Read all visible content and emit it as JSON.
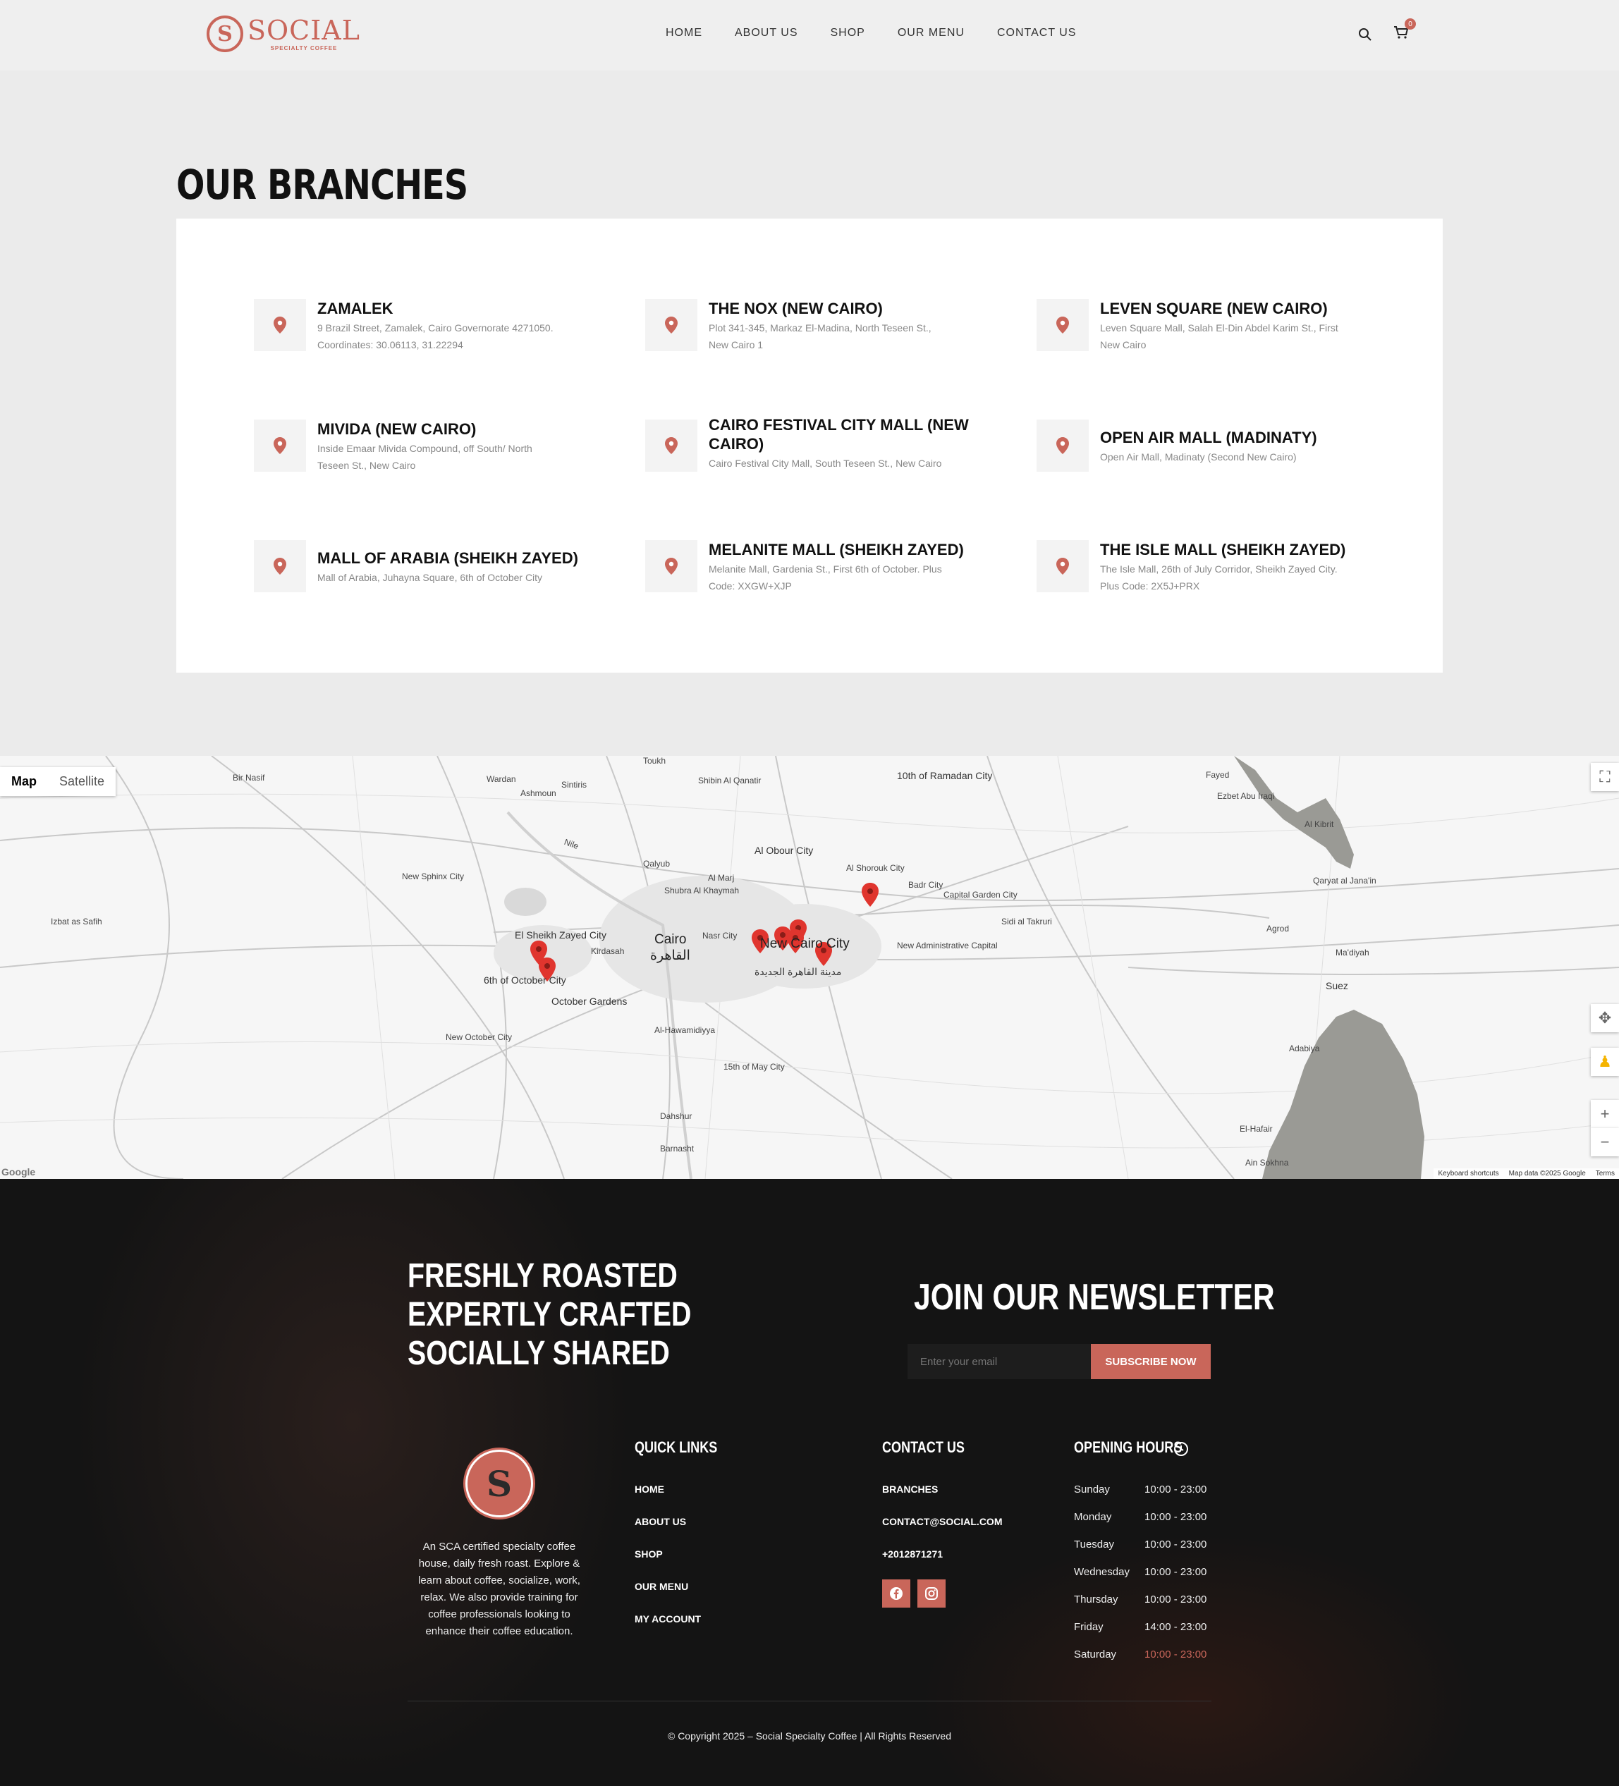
{
  "header": {
    "logo_word": "SOCIAL",
    "logo_sub": "SPECIALTY COFFEE",
    "nav": [
      "HOME",
      "ABOUT US",
      "SHOP",
      "OUR MENU",
      "CONTACT US"
    ],
    "cart_count": "0"
  },
  "branches": {
    "title": "OUR BRANCHES",
    "items": [
      {
        "name": "ZAMALEK",
        "addr1": "9 Brazil Street, Zamalek, Cairo Governorate 4271050.",
        "addr2": "Coordinates: 30.06113, 31.22294"
      },
      {
        "name": "THE NOX (NEW CAIRO)",
        "addr1": "Plot 341-345, Markaz El-Madina, North Teseen St.,",
        "addr2": "New Cairo 1"
      },
      {
        "name": "LEVEN SQUARE (NEW CAIRO)",
        "addr1": "Leven Square Mall, Salah El-Din Abdel Karim St., First",
        "addr2": "New Cairo"
      },
      {
        "name": "MIVIDA (NEW CAIRO)",
        "addr1": "Inside Emaar Mivida Compound, off South/ North",
        "addr2": "Teseen St., New Cairo"
      },
      {
        "name": "CAIRO FESTIVAL CITY MALL (NEW",
        "name2": "CAIRO)",
        "addr1": "Cairo Festival City Mall, South Teseen St., New Cairo",
        "addr2": ""
      },
      {
        "name": "OPEN AIR MALL (MADINATY)",
        "addr1": "Open Air Mall, Madinaty (Second New Cairo)",
        "addr2": ""
      },
      {
        "name": "MALL OF ARABIA (SHEIKH ZAYED)",
        "addr1": "Mall of Arabia, Juhayna Square, 6th of October City",
        "addr2": ""
      },
      {
        "name": "MELANITE MALL (SHEIKH ZAYED)",
        "addr1": "Melanite Mall, Gardenia St., First 6th of October. Plus",
        "addr2": "Code: XXGW+XJP"
      },
      {
        "name": "THE ISLE MALL (SHEIKH ZAYED)",
        "addr1": "The Isle Mall, 26th of July Corridor, Sheikh Zayed City.",
        "addr2": "Plus Code: 2X5J+PRX"
      }
    ]
  },
  "map": {
    "type_buttons": [
      "Map",
      "Satellite"
    ],
    "labels": [
      "Cairo",
      "القاهرة",
      "New Cairo City",
      "مدينة القاهرة الجديدة",
      "10th of Ramadan City",
      "Al Obour City",
      "Al Shorouk City",
      "Badr City",
      "El Sheikh Zayed City",
      "6th of October City",
      "October Gardens",
      "Kirdasah",
      "Nasr City",
      "Qalyub",
      "Shubra Al Khaymah",
      "Al Marj",
      "New Administrative Capital",
      "Al-Hawamidiyya",
      "15th of May City",
      "Dahshur",
      "Barnasht",
      "Suez",
      "Ma'diyah",
      "Agrod",
      "Adabiya",
      "El-Hafair",
      "Ain Sokhna",
      "Qaryat al Jana'in",
      "Sidi al Takruri",
      "Ezbet Abu Iraqi",
      "Al Kibrit",
      "Fayed",
      "Wardan",
      "Ashmoun",
      "Sintiris",
      "Shibin Al Qanatir",
      "Bir Nasif",
      "New Sphinx City",
      "Izbat as Safih",
      "New October City",
      "Toukh",
      "Capital Garden City",
      "Nile"
    ],
    "footer": [
      "Keyboard shortcuts",
      "Map data ©2025 Google",
      "Terms"
    ],
    "google": "Google"
  },
  "footer": {
    "tagline": [
      "FRESHLY ROASTED",
      "EXPERTLY CRAFTED",
      "SOCIALLY SHARED"
    ],
    "newsletter_title": "JOIN OUR NEWSLETTER",
    "email_placeholder": "Enter your email",
    "subscribe": "SUBSCRIBE NOW",
    "about": "An SCA certified specialty coffee house, daily fresh roast. Explore & learn about coffee, socialize, work, relax. We also provide training for coffee professionals looking to enhance their coffee education.",
    "quick_links_title": "QUICK LINKS",
    "quick_links": [
      "HOME",
      "ABOUT US",
      "SHOP",
      "OUR MENU",
      "MY ACCOUNT"
    ],
    "contact_title": "CONTACT US",
    "contact": [
      "BRANCHES",
      "CONTACT@SOCIAL.COM",
      "+2012871271"
    ],
    "hours_title": "OPENING HOURS",
    "hours": [
      {
        "day": "Sunday",
        "time": "10:00 - 23:00"
      },
      {
        "day": "Monday",
        "time": "10:00 - 23:00"
      },
      {
        "day": "Tuesday",
        "time": "10:00 - 23:00"
      },
      {
        "day": "Wednesday",
        "time": "10:00 - 23:00"
      },
      {
        "day": "Thursday",
        "time": "10:00 - 23:00"
      },
      {
        "day": "Friday",
        "time": "14:00 - 23:00"
      },
      {
        "day": "Saturday",
        "time": "10:00 - 23:00"
      }
    ],
    "copyright": "© Copyright 2025 – Social Specialty Coffee | All Rights Reserved"
  },
  "colors": {
    "accent": "#c9665a",
    "footer_bg": "#141414"
  }
}
